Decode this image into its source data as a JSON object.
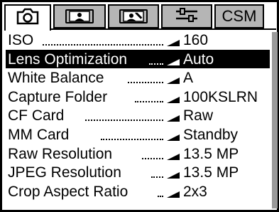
{
  "tabs": [
    {
      "icon": "camera-icon",
      "active": true
    },
    {
      "icon": "playback-image-icon",
      "active": false
    },
    {
      "icon": "image-edit-icon",
      "active": false
    },
    {
      "icon": "settings-sliders-icon",
      "active": false
    },
    {
      "label": "CSM",
      "active": false
    }
  ],
  "menu": {
    "items": [
      {
        "label": "ISO",
        "value": "160"
      },
      {
        "label": "Lens Optimization",
        "value": "Auto",
        "selected": true
      },
      {
        "label": "White Balance",
        "value": "A"
      },
      {
        "label": "Capture Folder",
        "value": "100KSLRN"
      },
      {
        "label": "CF Card",
        "value": "Raw"
      },
      {
        "label": "MM Card",
        "value": "Standby"
      },
      {
        "label": "Raw Resolution",
        "value": "13.5 MP"
      },
      {
        "label": "JPEG Resolution",
        "value": "13.5 MP"
      },
      {
        "label": "Crop Aspect Ratio",
        "value": "2x3"
      }
    ]
  },
  "scrollbar": {
    "position": 0.0,
    "visible_fraction": 1.0
  },
  "colors": {
    "tab_inactive": "#b5b5b5",
    "selected_row_bg": "#000000",
    "text": "#000000"
  }
}
